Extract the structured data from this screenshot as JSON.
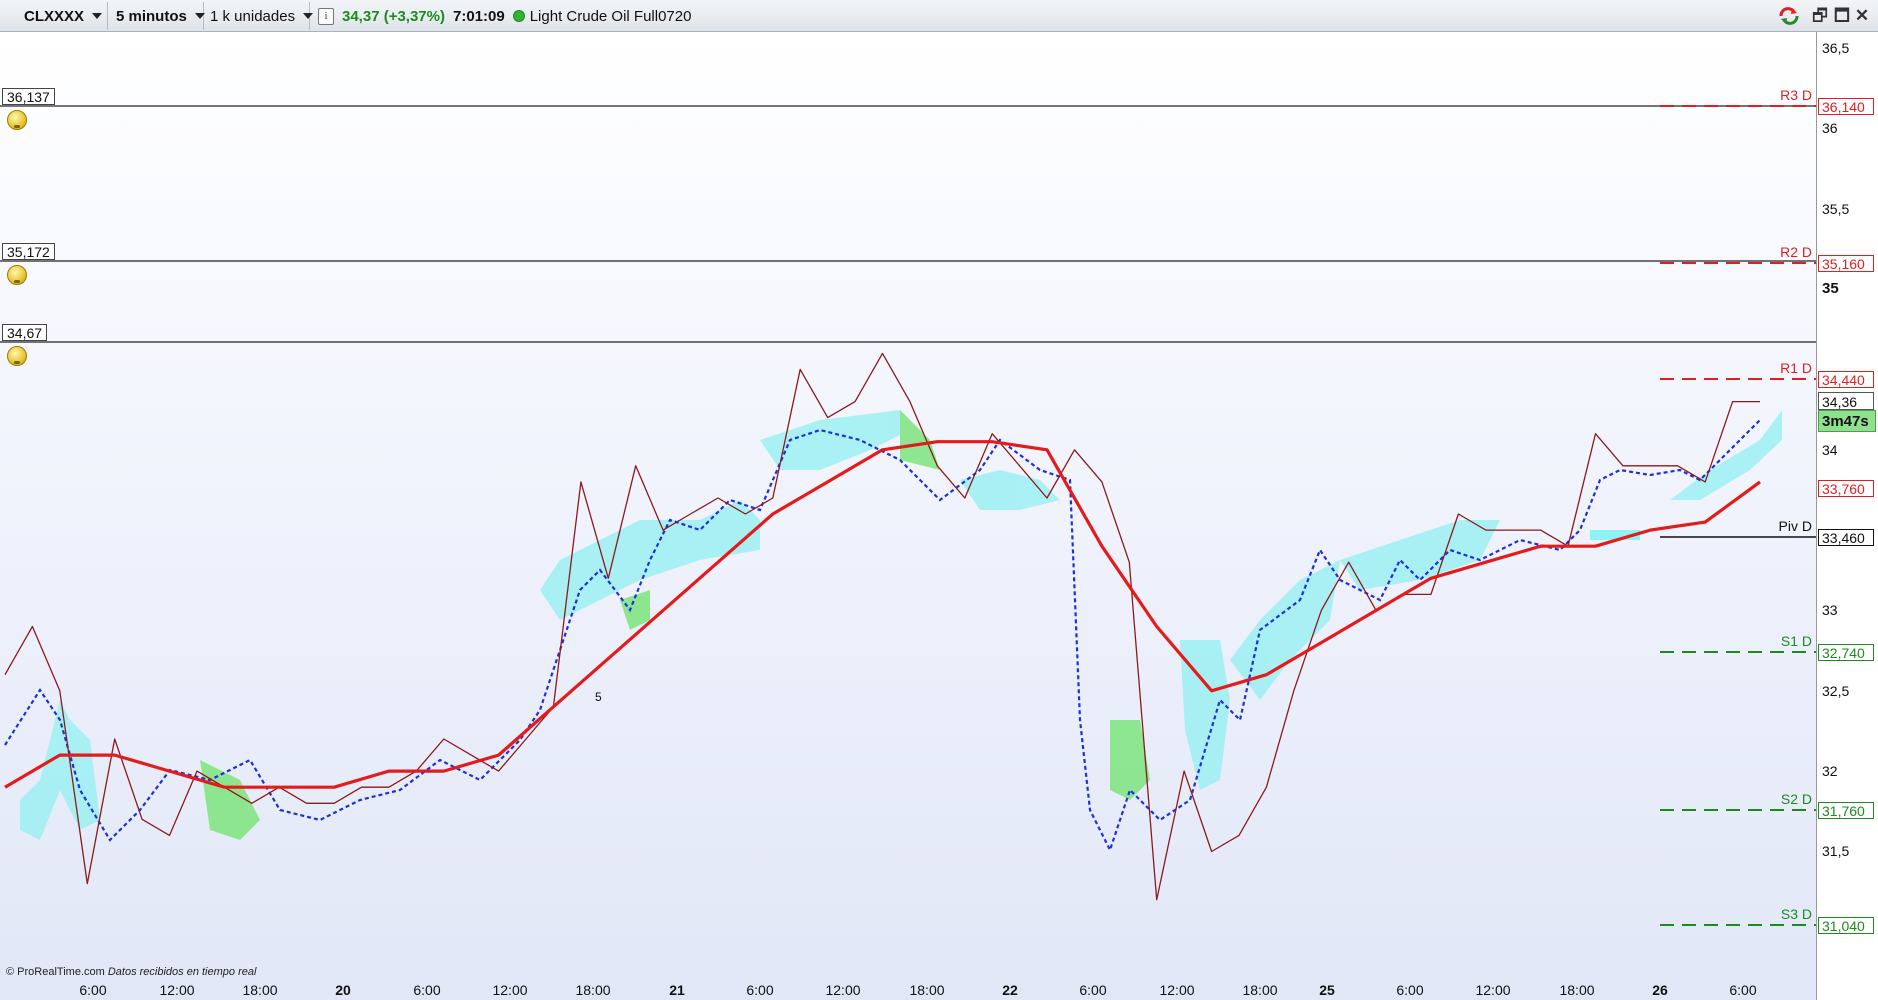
{
  "toolbar": {
    "symbol": "CLXXXX",
    "timeframe": "5 minutos",
    "units": "1 k unidades",
    "info_icon": "info-icon",
    "last_price": "34,37 (+3,37%)",
    "clock": "7:01:09",
    "instrument": "Light Crude Oil Full0720",
    "colors": {
      "up": "#1e8a1e",
      "status": "#2fb52f"
    }
  },
  "window_buttons": {
    "sync_icon": "sync-icon",
    "restore": "🗗",
    "maximize": "🗖",
    "close": "✕"
  },
  "alert_lines": [
    {
      "label": "36,137",
      "value": 36.137
    },
    {
      "label": "35,172",
      "value": 35.172
    },
    {
      "label": "34,67",
      "value": 34.67
    }
  ],
  "pivot_levels": [
    {
      "name": "R3 D",
      "value": 36.14,
      "price_label": "36,140",
      "color": "#e02020"
    },
    {
      "name": "R2 D",
      "value": 35.16,
      "price_label": "35,160",
      "color": "#e02020"
    },
    {
      "name": "R1 D",
      "value": 34.44,
      "price_label": "34,440",
      "color": "#e02020"
    },
    {
      "name": "",
      "value": 33.76,
      "price_label": "33,760",
      "color": "#e02020"
    },
    {
      "name": "Piv D",
      "value": 33.46,
      "price_label": "33,460",
      "color": "#111111"
    },
    {
      "name": "S1 D",
      "value": 32.74,
      "price_label": "32,740",
      "color": "#1e8a1e"
    },
    {
      "name": "S2 D",
      "value": 31.76,
      "price_label": "31,760",
      "color": "#1e8a1e"
    },
    {
      "name": "S3 D",
      "value": 31.04,
      "price_label": "31,040",
      "color": "#1e8a1e"
    }
  ],
  "current": {
    "price_label": "34,36",
    "timer": "3m47s"
  },
  "signal": {
    "count": "5"
  },
  "footer": {
    "source": "© ProRealTime.com",
    "note": "Datos recibidos en tiempo real"
  },
  "chart_data": {
    "type": "line",
    "ylim": [
      30.7,
      36.6
    ],
    "y_ticks": [
      {
        "value": 36.5,
        "label": "36,5",
        "major": false
      },
      {
        "value": 36,
        "label": "36",
        "major": false
      },
      {
        "value": 35.5,
        "label": "35,5",
        "major": false
      },
      {
        "value": 35,
        "label": "35",
        "major": true
      },
      {
        "value": 34,
        "label": "34",
        "major": false
      },
      {
        "value": 33,
        "label": "33",
        "major": false
      },
      {
        "value": 32.5,
        "label": "32,5",
        "major": false
      },
      {
        "value": 32,
        "label": "32",
        "major": false
      },
      {
        "value": 31.5,
        "label": "31,5",
        "major": false
      }
    ],
    "x_ticks": [
      {
        "label": "6:00",
        "major": false
      },
      {
        "label": "12:00",
        "major": false
      },
      {
        "label": "18:00",
        "major": false
      },
      {
        "label": "20",
        "major": true
      },
      {
        "label": "6:00",
        "major": false
      },
      {
        "label": "12:00",
        "major": false
      },
      {
        "label": "18:00",
        "major": false
      },
      {
        "label": "21",
        "major": true
      },
      {
        "label": "6:00",
        "major": false
      },
      {
        "label": "12:00",
        "major": false
      },
      {
        "label": "18:00",
        "major": false
      },
      {
        "label": "22",
        "major": true
      },
      {
        "label": "6:00",
        "major": false
      },
      {
        "label": "12:00",
        "major": false
      },
      {
        "label": "18:00",
        "major": false
      },
      {
        "label": "25",
        "major": true
      },
      {
        "label": "6:00",
        "major": false
      },
      {
        "label": "12:00",
        "major": false
      },
      {
        "label": "18:00",
        "major": false
      },
      {
        "label": "26",
        "major": true
      },
      {
        "label": "6:00",
        "major": false
      }
    ],
    "series": [
      {
        "color": "#8b1a1a",
        "values": [
          32.6,
          32.9,
          32.5,
          31.3,
          32.2,
          31.7,
          31.6,
          32.0,
          31.9,
          31.8,
          31.9,
          31.8,
          31.8,
          31.9,
          31.9,
          32.0,
          32.2,
          32.1,
          32.0,
          32.2,
          32.4,
          33.8,
          33.2,
          33.9,
          33.5,
          33.6,
          33.7,
          33.6,
          33.7,
          34.5,
          34.2,
          34.3,
          34.6,
          34.3,
          33.9,
          33.7,
          34.1,
          33.9,
          33.7,
          34.0,
          33.8,
          33.3,
          31.2,
          32.0,
          31.5,
          31.6,
          31.9,
          32.5,
          33.0,
          33.3,
          33.0,
          33.1,
          33.1,
          33.6,
          33.5,
          33.5,
          33.5,
          33.4,
          34.1,
          33.9,
          33.9,
          33.9,
          33.8,
          34.3,
          34.3
        ]
      },
      {
        "color": "#e31b1b",
        "values": [
          31.9,
          32.1,
          32.1,
          32.0,
          31.9,
          31.9,
          31.9,
          32.0,
          32.0,
          32.1,
          32.4,
          32.7,
          33.0,
          33.3,
          33.6,
          33.8,
          34.0,
          34.05,
          34.05,
          34.0,
          33.4,
          32.9,
          32.5,
          32.6,
          32.8,
          33.0,
          33.2,
          33.3,
          33.4,
          33.4,
          33.5,
          33.55,
          33.8
        ]
      }
    ]
  }
}
